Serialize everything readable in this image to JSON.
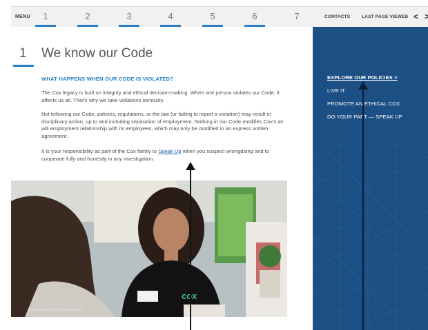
{
  "nav": {
    "menu_label": "MENU",
    "pages": [
      "1",
      "2",
      "3",
      "4",
      "5",
      "6",
      "7"
    ],
    "contacts_label": "CONTACTS",
    "last_page_label": "LAST PAGE VIEWED",
    "prev_glyph": "<",
    "next_glyph": ">"
  },
  "section": {
    "number": "1",
    "title": "We know our Code",
    "subheading": "WHAT HAPPENS WHEN OUR CODE IS VIOLATED?",
    "para1": "The Cox legacy is built on integrity and ethical decision-making. When one person violates our Code, it affects us all. That's why we take violations seriously.",
    "para2": "Not following our Code, policies, regulations, or the law (or failing to report a violation) may result in disciplinary action, up to and including separation of employment. Nothing in our Code modifies Cox's at-will employment relationship with its employees, which may only be modified in an express written agreement.",
    "para3_before": "It is your responsibility as part of the Cox family to ",
    "para3_link": "Speak Up",
    "para3_after": " when you suspect wrongdoing and to cooperate fully and honestly in any investigation."
  },
  "photo": {
    "caption": "Alyssa Perez, Cox Communications",
    "logo_text": "cox"
  },
  "sidebar": {
    "items": [
      {
        "label": "EXPLORE OUR POLICIES >",
        "active": true
      },
      {
        "label": "LIVE IT",
        "active": false
      },
      {
        "label": "PROMOTE AN ETHICAL COX",
        "active": false
      },
      {
        "label": "DO YOUR PART — SPEAK UP",
        "active": false
      }
    ]
  },
  "colors": {
    "accent": "#2a7fc4",
    "sidebar_bg": "#1c4f84",
    "link": "#1a5fa8"
  }
}
